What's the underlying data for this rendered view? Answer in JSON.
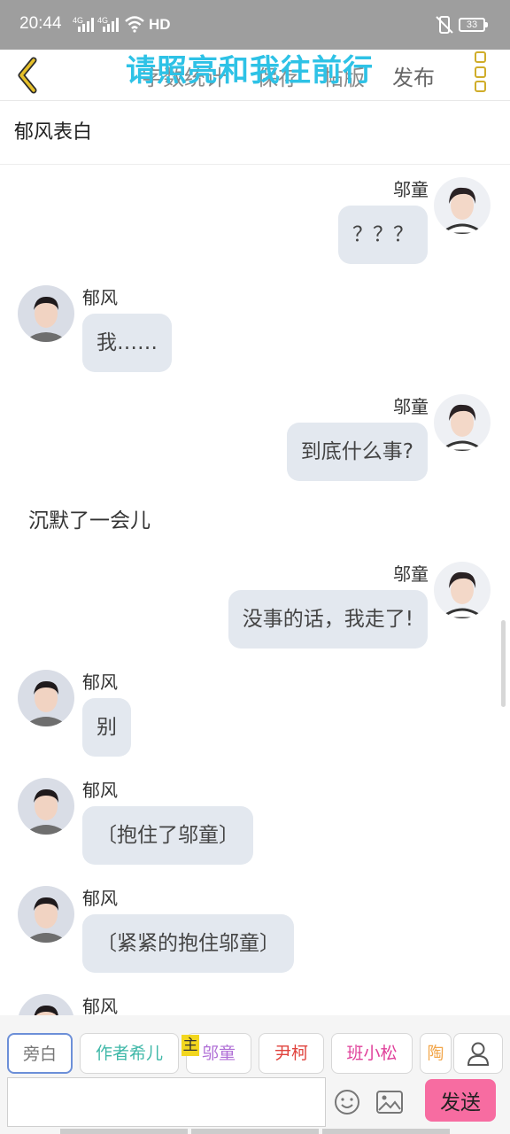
{
  "status_bar": {
    "time": "20:44",
    "signal1": "4G",
    "signal2": "4G",
    "hd": "HD",
    "battery": "33"
  },
  "toolbar": {
    "stats_label": "字数统计",
    "save_label": "保存",
    "layout_label": "帖版",
    "publish_label": "发布",
    "overlay_text": "请照亮和我往前行"
  },
  "story": {
    "title": "郁风表白"
  },
  "messages": [
    {
      "speaker": "邬童",
      "text": "？？？"
    },
    {
      "speaker": "郁风",
      "text": "我……"
    },
    {
      "speaker": "邬童",
      "text": "到底什么事?"
    },
    {
      "narration": "沉默了一会儿"
    },
    {
      "speaker": "邬童",
      "text": "没事的话，我走了!"
    },
    {
      "speaker": "郁风",
      "text": "别"
    },
    {
      "speaker": "郁风",
      "text": "〔抱住了邬童〕"
    },
    {
      "speaker": "郁风",
      "text": "〔紧紧的抱住邬童〕"
    },
    {
      "speaker": "郁风",
      "text": ""
    }
  ],
  "characters": [
    {
      "name": "旁白",
      "color": "#777777"
    },
    {
      "name": "作者希儿",
      "color": "#3fb8a8"
    },
    {
      "name": "邬童",
      "color": "#b06fd6",
      "badge": "主"
    },
    {
      "name": "尹柯",
      "color": "#e0423c"
    },
    {
      "name": "班小松",
      "color": "#e0409a"
    },
    {
      "name": "陶",
      "color": "#f2a64a"
    }
  ],
  "composer": {
    "placeholder": "",
    "send_label": "发送"
  }
}
